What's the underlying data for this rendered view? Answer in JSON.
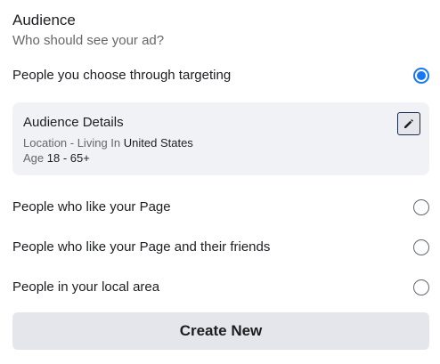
{
  "section": {
    "title": "Audience",
    "subtitle": "Who should see your ad?"
  },
  "options": [
    {
      "label": "People you choose through targeting",
      "selected": true
    },
    {
      "label": "People who like your Page",
      "selected": false
    },
    {
      "label": "People who like your Page and their friends",
      "selected": false
    },
    {
      "label": "People in your local area",
      "selected": false
    }
  ],
  "audience_details": {
    "title": "Audience Details",
    "location_label": "Location - Living In",
    "location_value": "United States",
    "age_label": "Age",
    "age_value": "18 - 65+",
    "edit_icon": "pencil-icon"
  },
  "create_new_label": "Create New",
  "colors": {
    "accent": "#1877f2",
    "card_bg": "#f0f2f5",
    "button_bg": "#e4e6eb",
    "secondary_text": "#65676b"
  }
}
